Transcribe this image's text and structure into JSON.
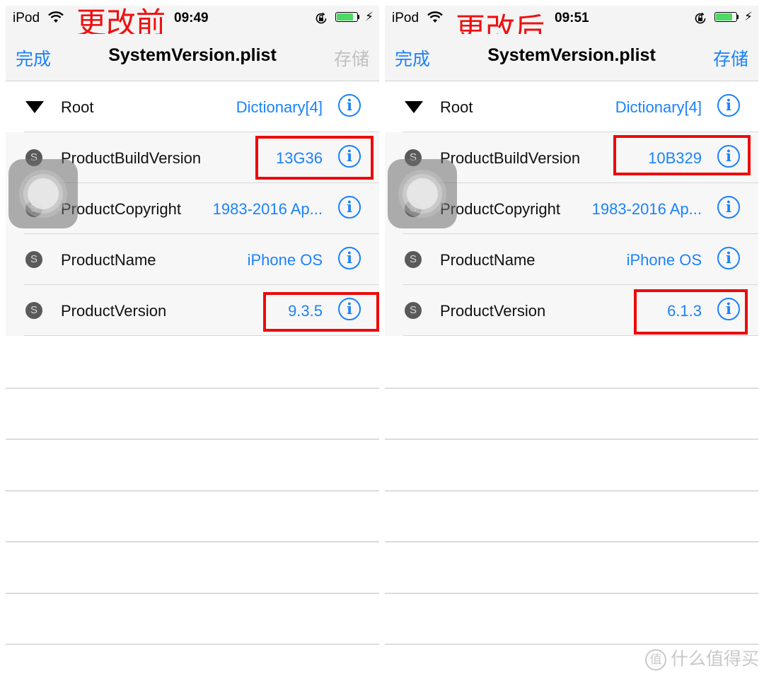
{
  "screens": [
    {
      "annotation": "更改前",
      "status_bar": {
        "carrier": "iPod",
        "time": "09:49",
        "wifi_icon": "wifi-icon",
        "lock_icon": "rotation-lock-icon",
        "battery_icon": "battery-charging-icon",
        "charging_icon": "bolt-icon"
      },
      "navbar": {
        "done_label": "完成",
        "title": "SystemVersion.plist",
        "save_label": "存储",
        "save_enabled": false
      },
      "root": {
        "key": "Root",
        "value": "Dictionary[4]"
      },
      "rows": [
        {
          "type_badge": "S",
          "key": "ProductBuildVersion",
          "value": "13G36",
          "highlighted": true
        },
        {
          "type_badge": "S",
          "key": "ProductCopyright",
          "value": "1983-2016 Ap...",
          "highlighted": false
        },
        {
          "type_badge": "S",
          "key": "ProductName",
          "value": "iPhone OS",
          "highlighted": false
        },
        {
          "type_badge": "S",
          "key": "ProductVersion",
          "value": "9.3.5",
          "highlighted": true
        }
      ],
      "info_glyph": "i"
    },
    {
      "annotation": "更改后",
      "status_bar": {
        "carrier": "iPod",
        "time": "09:51",
        "wifi_icon": "wifi-icon",
        "lock_icon": "rotation-lock-icon",
        "battery_icon": "battery-charging-icon",
        "charging_icon": "bolt-icon"
      },
      "navbar": {
        "done_label": "完成",
        "title": "SystemVersion.plist",
        "save_label": "存储",
        "save_enabled": true
      },
      "root": {
        "key": "Root",
        "value": "Dictionary[4]"
      },
      "rows": [
        {
          "type_badge": "S",
          "key": "ProductBuildVersion",
          "value": "10B329",
          "highlighted": true
        },
        {
          "type_badge": "S",
          "key": "ProductCopyright",
          "value": "1983-2016 Ap...",
          "highlighted": false
        },
        {
          "type_badge": "S",
          "key": "ProductName",
          "value": "iPhone OS",
          "highlighted": false
        },
        {
          "type_badge": "S",
          "key": "ProductVersion",
          "value": "6.1.3",
          "highlighted": true
        }
      ],
      "info_glyph": "i"
    }
  ],
  "watermark": {
    "icon_glyph": "值",
    "text": "什么值得买"
  },
  "colors": {
    "accent": "#1a82fb",
    "disabled": "#c0c0c0",
    "highlight": "#ee0a0a",
    "annotation": "#ef1010",
    "battery": "#4cd964"
  }
}
